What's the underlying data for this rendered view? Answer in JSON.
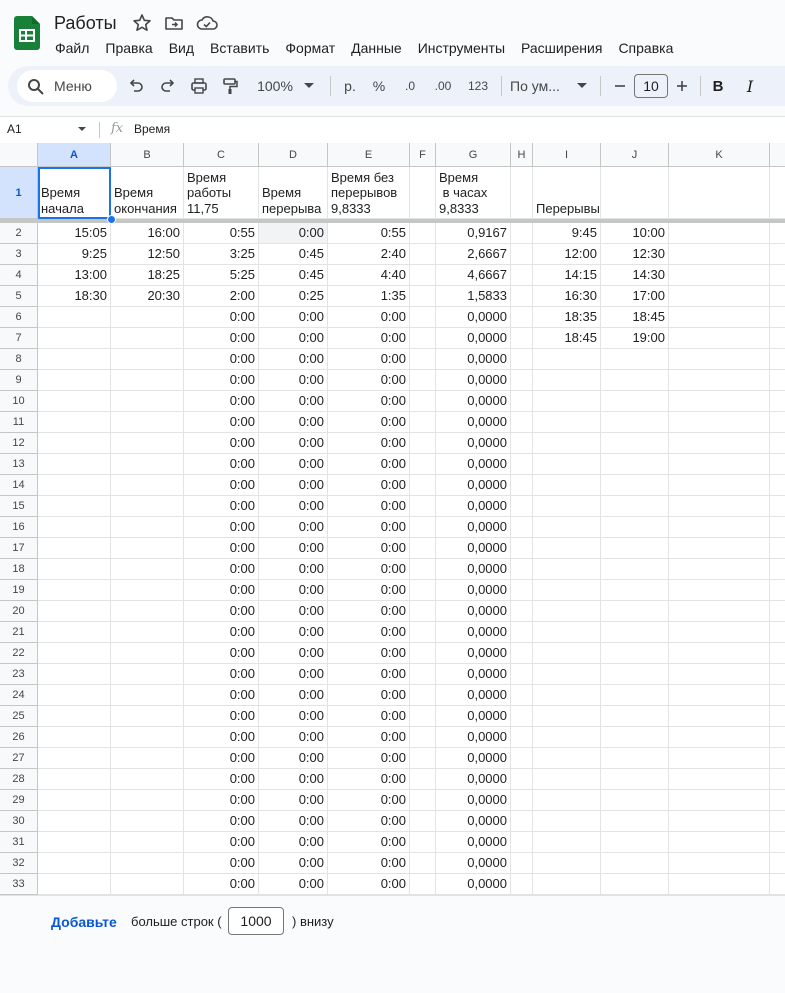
{
  "doc": {
    "title": "Работы",
    "star_icon": "star-icon",
    "move_icon": "move-to-folder-icon",
    "cloud_icon": "cloud-saved-icon",
    "brand_color": "#188038"
  },
  "menu": [
    "Файл",
    "Правка",
    "Вид",
    "Вставить",
    "Формат",
    "Данные",
    "Инструменты",
    "Расширения",
    "Справка"
  ],
  "toolbar": {
    "search_label": "Меню",
    "zoom": "100%",
    "currency": "р.",
    "percent": "%",
    "decrease_decimals": ".0",
    "increase_decimals": ".00",
    "number_format": "123",
    "font": "По ум...",
    "font_size": "10",
    "bold": "B",
    "italic": "I"
  },
  "formula_bar": {
    "cell_ref": "A1",
    "content": "Время"
  },
  "grid": {
    "columns": [
      "A",
      "B",
      "C",
      "D",
      "E",
      "F",
      "G",
      "H",
      "I",
      "J",
      "K"
    ],
    "header_row": [
      "Время\nначала",
      "Время\nокончания",
      "Время\nработы\n11,75",
      "Время\nперерыва",
      "Время без\nперерывов\n9,8333",
      "",
      "Время\n в часах\n9,8333",
      "",
      "Перерывы",
      "",
      ""
    ],
    "rows": [
      [
        "15:05",
        "16:00",
        "0:55",
        "0:00",
        "0:55",
        "",
        "0,9167",
        "",
        "9:45",
        "10:00",
        ""
      ],
      [
        "9:25",
        "12:50",
        "3:25",
        "0:45",
        "2:40",
        "",
        "2,6667",
        "",
        "12:00",
        "12:30",
        ""
      ],
      [
        "13:00",
        "18:25",
        "5:25",
        "0:45",
        "4:40",
        "",
        "4,6667",
        "",
        "14:15",
        "14:30",
        ""
      ],
      [
        "18:30",
        "20:30",
        "2:00",
        "0:25",
        "1:35",
        "",
        "1,5833",
        "",
        "16:30",
        "17:00",
        ""
      ],
      [
        "",
        "",
        "0:00",
        "0:00",
        "0:00",
        "",
        "0,0000",
        "",
        "18:35",
        "18:45",
        ""
      ],
      [
        "",
        "",
        "0:00",
        "0:00",
        "0:00",
        "",
        "0,0000",
        "",
        "18:45",
        "19:00",
        ""
      ],
      [
        "",
        "",
        "0:00",
        "0:00",
        "0:00",
        "",
        "0,0000",
        "",
        "",
        "",
        ""
      ],
      [
        "",
        "",
        "0:00",
        "0:00",
        "0:00",
        "",
        "0,0000",
        "",
        "",
        "",
        ""
      ],
      [
        "",
        "",
        "0:00",
        "0:00",
        "0:00",
        "",
        "0,0000",
        "",
        "",
        "",
        ""
      ],
      [
        "",
        "",
        "0:00",
        "0:00",
        "0:00",
        "",
        "0,0000",
        "",
        "",
        "",
        ""
      ],
      [
        "",
        "",
        "0:00",
        "0:00",
        "0:00",
        "",
        "0,0000",
        "",
        "",
        "",
        ""
      ],
      [
        "",
        "",
        "0:00",
        "0:00",
        "0:00",
        "",
        "0,0000",
        "",
        "",
        "",
        ""
      ],
      [
        "",
        "",
        "0:00",
        "0:00",
        "0:00",
        "",
        "0,0000",
        "",
        "",
        "",
        ""
      ],
      [
        "",
        "",
        "0:00",
        "0:00",
        "0:00",
        "",
        "0,0000",
        "",
        "",
        "",
        ""
      ],
      [
        "",
        "",
        "0:00",
        "0:00",
        "0:00",
        "",
        "0,0000",
        "",
        "",
        "",
        ""
      ],
      [
        "",
        "",
        "0:00",
        "0:00",
        "0:00",
        "",
        "0,0000",
        "",
        "",
        "",
        ""
      ],
      [
        "",
        "",
        "0:00",
        "0:00",
        "0:00",
        "",
        "0,0000",
        "",
        "",
        "",
        ""
      ],
      [
        "",
        "",
        "0:00",
        "0:00",
        "0:00",
        "",
        "0,0000",
        "",
        "",
        "",
        ""
      ],
      [
        "",
        "",
        "0:00",
        "0:00",
        "0:00",
        "",
        "0,0000",
        "",
        "",
        "",
        ""
      ],
      [
        "",
        "",
        "0:00",
        "0:00",
        "0:00",
        "",
        "0,0000",
        "",
        "",
        "",
        ""
      ],
      [
        "",
        "",
        "0:00",
        "0:00",
        "0:00",
        "",
        "0,0000",
        "",
        "",
        "",
        ""
      ],
      [
        "",
        "",
        "0:00",
        "0:00",
        "0:00",
        "",
        "0,0000",
        "",
        "",
        "",
        ""
      ],
      [
        "",
        "",
        "0:00",
        "0:00",
        "0:00",
        "",
        "0,0000",
        "",
        "",
        "",
        ""
      ],
      [
        "",
        "",
        "0:00",
        "0:00",
        "0:00",
        "",
        "0,0000",
        "",
        "",
        "",
        ""
      ],
      [
        "",
        "",
        "0:00",
        "0:00",
        "0:00",
        "",
        "0,0000",
        "",
        "",
        "",
        ""
      ],
      [
        "",
        "",
        "0:00",
        "0:00",
        "0:00",
        "",
        "0,0000",
        "",
        "",
        "",
        ""
      ],
      [
        "",
        "",
        "0:00",
        "0:00",
        "0:00",
        "",
        "0,0000",
        "",
        "",
        "",
        ""
      ],
      [
        "",
        "",
        "0:00",
        "0:00",
        "0:00",
        "",
        "0,0000",
        "",
        "",
        "",
        ""
      ],
      [
        "",
        "",
        "0:00",
        "0:00",
        "0:00",
        "",
        "0,0000",
        "",
        "",
        "",
        ""
      ],
      [
        "",
        "",
        "0:00",
        "0:00",
        "0:00",
        "",
        "0,0000",
        "",
        "",
        "",
        ""
      ],
      [
        "",
        "",
        "0:00",
        "0:00",
        "0:00",
        "",
        "0,0000",
        "",
        "",
        "",
        ""
      ],
      [
        "",
        "",
        "0:00",
        "0:00",
        "0:00",
        "",
        "0,0000",
        "",
        "",
        "",
        ""
      ]
    ],
    "selected_cell": "A1"
  },
  "footer": {
    "add_label": "Добавьте",
    "text": "больше строк (",
    "rows_value": "1000",
    "suffix": ") внизу"
  }
}
